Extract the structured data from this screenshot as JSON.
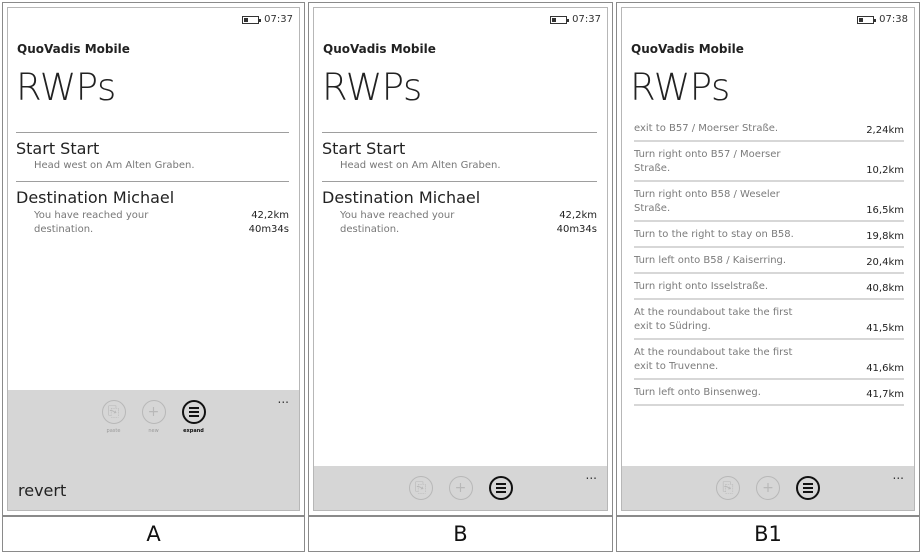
{
  "panels": [
    {
      "label": "A",
      "time": "07:37",
      "app_title": "QuoVadis Mobile",
      "page_title": "RWPs",
      "start": {
        "title": "Start Start",
        "desc": "Head west on Am Alten Graben."
      },
      "destination": {
        "title": "Destination Michael",
        "desc": "You have reached your destination.",
        "distance": "42,2km",
        "duration": "40m34s"
      },
      "appbar": {
        "paste": "paste",
        "new": "new",
        "expand": "expand",
        "more": "...",
        "revert": "revert"
      }
    },
    {
      "label": "B",
      "time": "07:37",
      "app_title": "QuoVadis Mobile",
      "page_title": "RWPs",
      "start": {
        "title": "Start Start",
        "desc": "Head west on Am Alten Graben."
      },
      "destination": {
        "title": "Destination Michael",
        "desc": "You have reached your destination.",
        "distance": "42,2km",
        "duration": "40m34s"
      },
      "appbar": {
        "more": "..."
      }
    },
    {
      "label": "B1",
      "time": "07:38",
      "app_title": "QuoVadis Mobile",
      "page_title": "RWPs",
      "route": [
        {
          "text": "exit to B57 / Moerser Straße.",
          "dist": "2,24km"
        },
        {
          "text": "Turn right onto B57 / Moerser Straße.",
          "dist": "10,2km"
        },
        {
          "text": "Turn right onto B58 / Weseler Straße.",
          "dist": "16,5km"
        },
        {
          "text": "Turn to the right to stay on B58.",
          "dist": "19,8km"
        },
        {
          "text": "Turn left onto B58 / Kaiserring.",
          "dist": "20,4km"
        },
        {
          "text": "Turn right onto Isselstraße.",
          "dist": "40,8km"
        },
        {
          "text": "At the roundabout take the first exit to Südring.",
          "dist": "41,5km"
        },
        {
          "text": "At the roundabout take the first exit to Truvenne.",
          "dist": "41,6km"
        },
        {
          "text": "Turn left onto Binsenweg.",
          "dist": "41,7km"
        }
      ],
      "appbar": {
        "more": "..."
      }
    }
  ]
}
